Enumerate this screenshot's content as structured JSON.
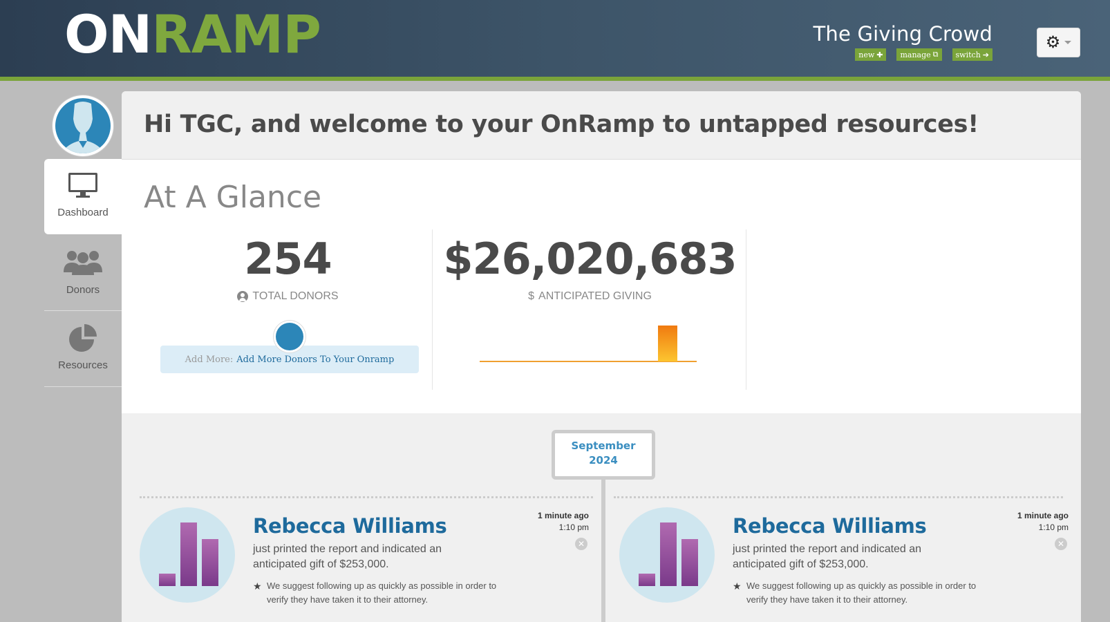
{
  "header": {
    "logo_on": "ON",
    "logo_ramp": "RAMP",
    "org_name": "The Giving Crowd",
    "actions": [
      {
        "label": "new",
        "icon": "plus-icon"
      },
      {
        "label": "manage",
        "icon": "external-edit-icon"
      },
      {
        "label": "switch",
        "icon": "arrow-right-icon"
      }
    ],
    "settings_icon": "gear-icon"
  },
  "sidebar": {
    "items": [
      {
        "label": "Dashboard",
        "icon": "monitor-icon",
        "active": true
      },
      {
        "label": "Donors",
        "icon": "users-icon",
        "active": false
      },
      {
        "label": "Resources",
        "icon": "pie-chart-icon",
        "active": false
      }
    ]
  },
  "main": {
    "welcome": "Hi TGC, and welcome to your OnRamp to untapped resources!",
    "glance_title": "At A Glance",
    "stats": {
      "donors_value": "254",
      "donors_label": "TOTAL DONORS",
      "giving_value": "$26,020,683",
      "giving_label": "ANTICIPATED GIVING",
      "giving_label_prefix": "$"
    },
    "add_more": {
      "prefix": "Add More:",
      "link": "Add More Donors To Your Onramp"
    }
  },
  "feed": {
    "month": "September",
    "year": "2024",
    "cards": [
      {
        "name": "Rebecca Williams",
        "desc": "just printed the report and indicated an anticipated gift of $253,000.",
        "tip": "We suggest following up as quickly as possible in order to verify they have taken it to their attorney.",
        "time_rel": "1 minute ago",
        "time_abs": "1:10 pm"
      },
      {
        "name": "Rebecca Williams",
        "desc": "just printed the report and indicated an anticipated gift of $253,000.",
        "tip": "We suggest following up as quickly as possible in order to verify they have taken it to their attorney.",
        "time_rel": "1 minute ago",
        "time_abs": "1:10 pm"
      }
    ]
  },
  "colors": {
    "brand_green": "#7aa43a",
    "brand_blue": "#1e6a9c",
    "header_dark": "#2c3e52",
    "spark_orange": "#f5a623"
  }
}
